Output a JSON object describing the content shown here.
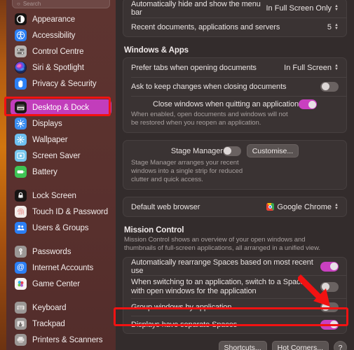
{
  "sidebar": {
    "search": {
      "placeholder": "Search",
      "icon": "search-icon"
    },
    "groups": [
      {
        "items": [
          {
            "label": "Appearance",
            "icon": "appearance-icon"
          },
          {
            "label": "Accessibility",
            "icon": "accessibility-icon"
          },
          {
            "label": "Control Centre",
            "icon": "control-centre-icon"
          },
          {
            "label": "Siri & Spotlight",
            "icon": "siri-icon"
          },
          {
            "label": "Privacy & Security",
            "icon": "privacy-security-icon"
          }
        ]
      },
      {
        "items": [
          {
            "label": "Desktop & Dock",
            "icon": "desktop-dock-icon",
            "selected": true
          },
          {
            "label": "Displays",
            "icon": "displays-icon"
          },
          {
            "label": "Wallpaper",
            "icon": "wallpaper-icon"
          },
          {
            "label": "Screen Saver",
            "icon": "screen-saver-icon"
          },
          {
            "label": "Battery",
            "icon": "battery-icon"
          }
        ]
      },
      {
        "items": [
          {
            "label": "Lock Screen",
            "icon": "lock-screen-icon"
          },
          {
            "label": "Touch ID & Password",
            "icon": "touch-id-icon"
          },
          {
            "label": "Users & Groups",
            "icon": "users-groups-icon"
          }
        ]
      },
      {
        "items": [
          {
            "label": "Passwords",
            "icon": "passwords-icon"
          },
          {
            "label": "Internet Accounts",
            "icon": "internet-accounts-icon"
          },
          {
            "label": "Game Center",
            "icon": "game-center-icon"
          }
        ]
      },
      {
        "items": [
          {
            "label": "Keyboard",
            "icon": "keyboard-icon"
          },
          {
            "label": "Trackpad",
            "icon": "trackpad-icon"
          },
          {
            "label": "Printers & Scanners",
            "icon": "printers-scanners-icon"
          }
        ]
      }
    ]
  },
  "main": {
    "menu_bar_card": {
      "auto_hide_menu_bar": {
        "label": "Automatically hide and show the menu bar",
        "value": "In Full Screen Only"
      },
      "recent_documents": {
        "label": "Recent documents, applications and servers",
        "value": "5"
      }
    },
    "windows_apps": {
      "section_title": "Windows & Apps",
      "prefer_tabs": {
        "label": "Prefer tabs when opening documents",
        "value": "In Full Screen"
      },
      "ask_keep_changes": {
        "label": "Ask to keep changes when closing documents",
        "toggle": "off"
      },
      "close_windows_quitting": {
        "label": "Close windows when quitting an application",
        "description": "When enabled, open documents and windows will not be restored when you reopen an application.",
        "toggle": "on"
      }
    },
    "stage_manager": {
      "label": "Stage Manager",
      "description": "Stage Manager arranges your recent windows into a single strip for reduced clutter and quick access.",
      "toggle": "off",
      "customise_label": "Customise..."
    },
    "default_browser": {
      "label": "Default web browser",
      "value": "Google Chrome",
      "icon": "google-chrome-icon"
    },
    "mission_control": {
      "section_title": "Mission Control",
      "section_description": "Mission Control shows an overview of your open windows and thumbnails of full-screen applications, all arranged in a unified view.",
      "auto_rearrange_spaces": {
        "label": "Automatically rearrange Spaces based on most recent use",
        "toggle": "on"
      },
      "switch_to_space": {
        "label": "When switching to an application, switch to a Space with open windows for the application",
        "toggle": "off"
      },
      "group_windows": {
        "label": "Group windows by application",
        "toggle": "off"
      },
      "displays_separate_spaces": {
        "label": "Displays have separate Spaces",
        "toggle": "on"
      }
    },
    "footer": {
      "shortcuts_label": "Shortcuts...",
      "hot_corners_label": "Hot Corners...",
      "help_label": "?"
    }
  },
  "annotations": {
    "highlight_color": "#f21212",
    "accent_color": "#c940c0",
    "selected_item_color": "#c23dbb"
  }
}
